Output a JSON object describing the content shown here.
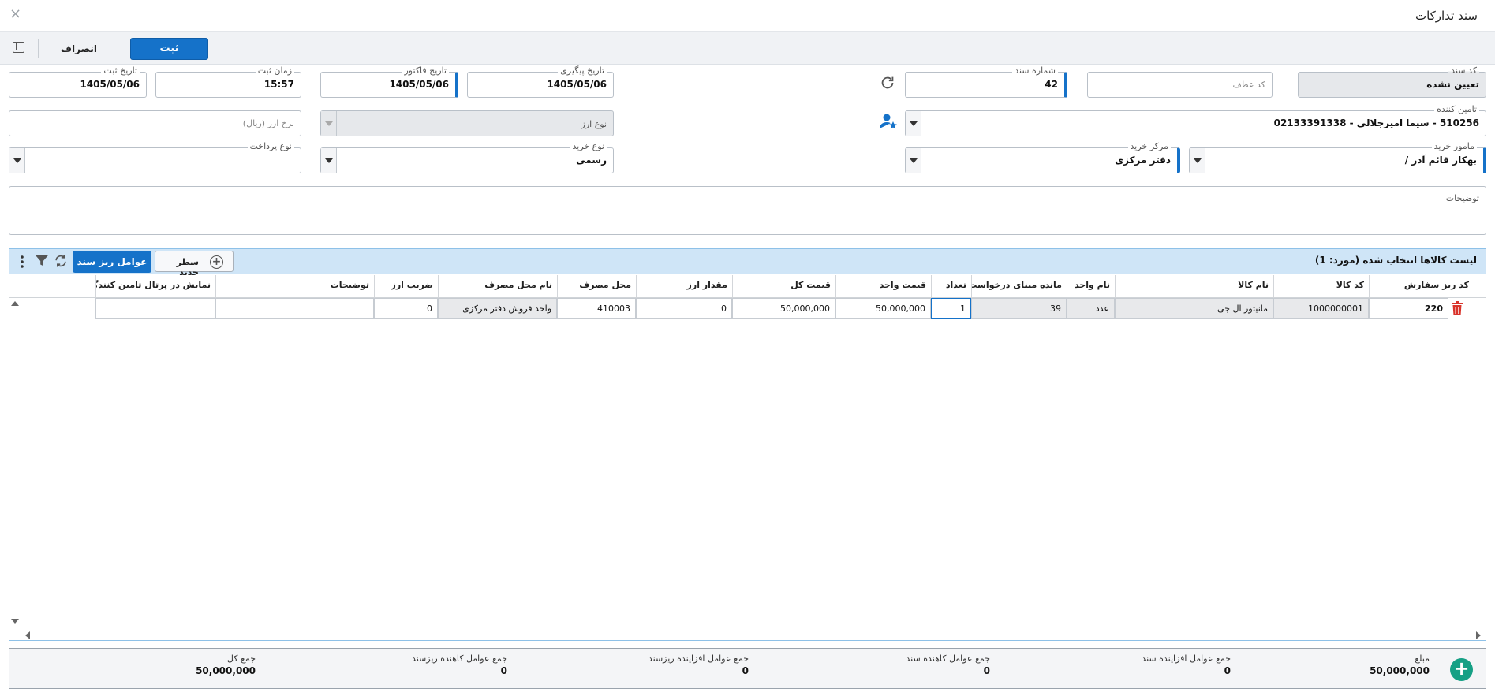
{
  "window": {
    "title": "سند تدارکات",
    "close_glyph": "×"
  },
  "toolbar": {
    "save_label": "ثبت",
    "cancel_label": "انصراف"
  },
  "form": {
    "doc_code": {
      "label": "کد سند",
      "value": "تعیین نشده"
    },
    "reference_code": {
      "placeholder": "کد عطف"
    },
    "doc_number": {
      "label": "شماره سند",
      "value": "42"
    },
    "followup_date": {
      "label": "تاریخ پیگیری",
      "value": "1405/05/06"
    },
    "invoice_date": {
      "label": "تاریخ فاکتور",
      "value": "1405/05/06"
    },
    "reg_time": {
      "label": "زمان ثبت",
      "value": "15:57"
    },
    "reg_date": {
      "label": "تاریخ ثبت",
      "value": "1405/05/06"
    },
    "supplier": {
      "label": "تامین کننده",
      "value": "510256 - سیما امیرجلالی - 02133391338"
    },
    "currency_type": {
      "placeholder": "نوع ارز"
    },
    "currency_rate": {
      "placeholder": "نرخ ارز (ریال)"
    },
    "buyer": {
      "label": "مامور خرید",
      "value": "بهکار قائم آذر /"
    },
    "purchase_center": {
      "label": "مرکز خرید",
      "value": "دفتر مرکزی"
    },
    "purchase_type": {
      "label": "نوع خرید",
      "value": "رسمی"
    },
    "payment_type": {
      "label": "نوع پرداخت",
      "value": ""
    },
    "description": {
      "label": "توضیحات",
      "value": ""
    }
  },
  "grid": {
    "title": "لیست کالاها انتخاب شده (مورد: 1)",
    "new_row_label": "سطر جدید",
    "subfactors_label": "عوامل ریز سند",
    "columns": [
      "کد ریز سفارش",
      "کد کالا",
      "نام کالا",
      "نام واحد",
      "مانده مبنای درخواست",
      "تعداد",
      "قیمت واحد",
      "قیمت کل",
      "مقدار ارز",
      "محل مصرف",
      "نام محل مصرف",
      "ضریب ارز",
      "توضیحات",
      "نمایش در پرتال تامین کنندگان"
    ],
    "rows": [
      {
        "order_detail_code": "220",
        "item_code": "1000000001",
        "item_name": "مانیتور ال جی",
        "unit_name": "عدد",
        "request_remaining": "39",
        "quantity": "1",
        "unit_price": "50,000,000",
        "total_price": "50,000,000",
        "currency_amount": "0",
        "consumption_place": "410003",
        "consumption_place_name": "واحد فروش دفتر مرکزی",
        "currency_factor": "0",
        "notes": "",
        "show_in_portal": ""
      }
    ]
  },
  "totals": {
    "amount": {
      "label": "مبلغ",
      "value": "50,000,000"
    },
    "doc_increasing": {
      "label": "جمع عوامل افزاینده سند",
      "value": "0"
    },
    "doc_decreasing": {
      "label": "جمع عوامل کاهنده سند",
      "value": "0"
    },
    "detail_increasing": {
      "label": "جمع عوامل افزاینده ریزسند",
      "value": "0"
    },
    "detail_decreasing": {
      "label": "جمع عوامل کاهنده ریزسند",
      "value": "0"
    },
    "grand_total": {
      "label": "جمع کل",
      "value": "50,000,000"
    }
  },
  "colors": {
    "accent": "#1572c9",
    "grid_header": "#cfe5f7",
    "delete": "#d9342b",
    "add": "#16a085"
  }
}
